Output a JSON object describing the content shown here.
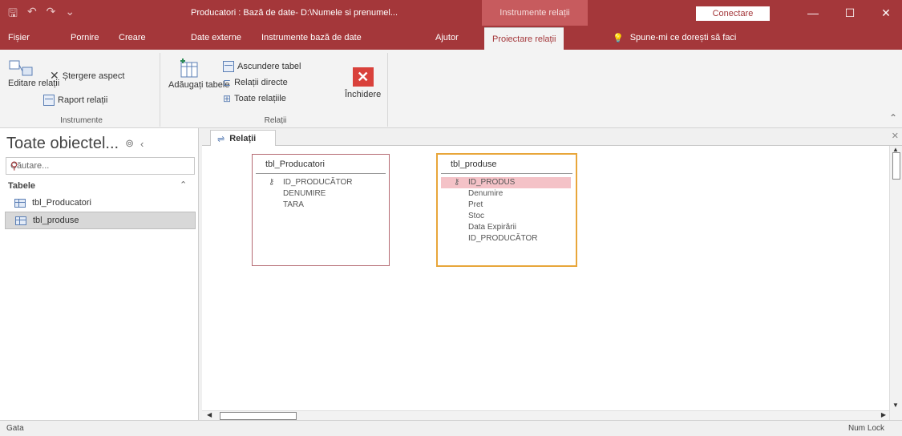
{
  "title_bar": {
    "document_title": "Producatori : Bază de date- D:\\Numele si prenumel...",
    "context_title": "Instrumente relații",
    "connect_label": "Conectare",
    "minimize": "—",
    "maximize": "☐",
    "close": "✕"
  },
  "tabs": [
    {
      "label": "Fișier"
    },
    {
      "label": "Pornire"
    },
    {
      "label": "Creare"
    },
    {
      "label": "Date externe"
    },
    {
      "label": "Instrumente bază de date"
    },
    {
      "label": "Ajutor"
    },
    {
      "label": "Proiectare relații"
    }
  ],
  "tell_me": "Spune-mi ce dorești să faci",
  "ribbon": {
    "tools_group": {
      "label": "Instrumente",
      "edit_relationships": "Editare relații",
      "clear_layout": "Ștergere aspect",
      "relationship_report": "Raport relații"
    },
    "relationships_group": {
      "label": "Relații",
      "add_tables": "Adăugați tabele",
      "hide_table": "Ascundere tabel",
      "direct_relationships": "Relații directe",
      "all_relationships": "Toate relațiile",
      "close": "Închidere"
    }
  },
  "nav_pane": {
    "title": "Toate obiectel...",
    "search_placeholder": "Căutare...",
    "category": "Tabele",
    "items": [
      {
        "label": "tbl_Producatori"
      },
      {
        "label": "tbl_produse"
      }
    ]
  },
  "document": {
    "tab_label": "Relații"
  },
  "tables": [
    {
      "name": "tbl_Producatori",
      "fields": [
        {
          "label": "ID_PRODUCĂTOR",
          "key": true
        },
        {
          "label": "DENUMIRE",
          "key": false
        },
        {
          "label": "TARA",
          "key": false
        }
      ]
    },
    {
      "name": "tbl_produse",
      "fields": [
        {
          "label": "ID_PRODUS",
          "key": true
        },
        {
          "label": "Denumire",
          "key": false
        },
        {
          "label": "Pret",
          "key": false
        },
        {
          "label": "Stoc",
          "key": false
        },
        {
          "label": "Data Expirării",
          "key": false
        },
        {
          "label": "ID_PRODUCĂTOR",
          "key": false
        }
      ]
    }
  ],
  "status_bar": {
    "left": "Gata",
    "right": "Num Lock"
  },
  "colors": {
    "accent": "#a4373a",
    "selected_table_border": "#e8a63a",
    "table_border": "#b56a72",
    "highlight_field": "#f4c2c7"
  },
  "icons": [
    "save-icon",
    "undo-icon",
    "redo-icon",
    "key-icon",
    "table-icon",
    "lightbulb-icon",
    "search-icon",
    "relationship-icon"
  ]
}
